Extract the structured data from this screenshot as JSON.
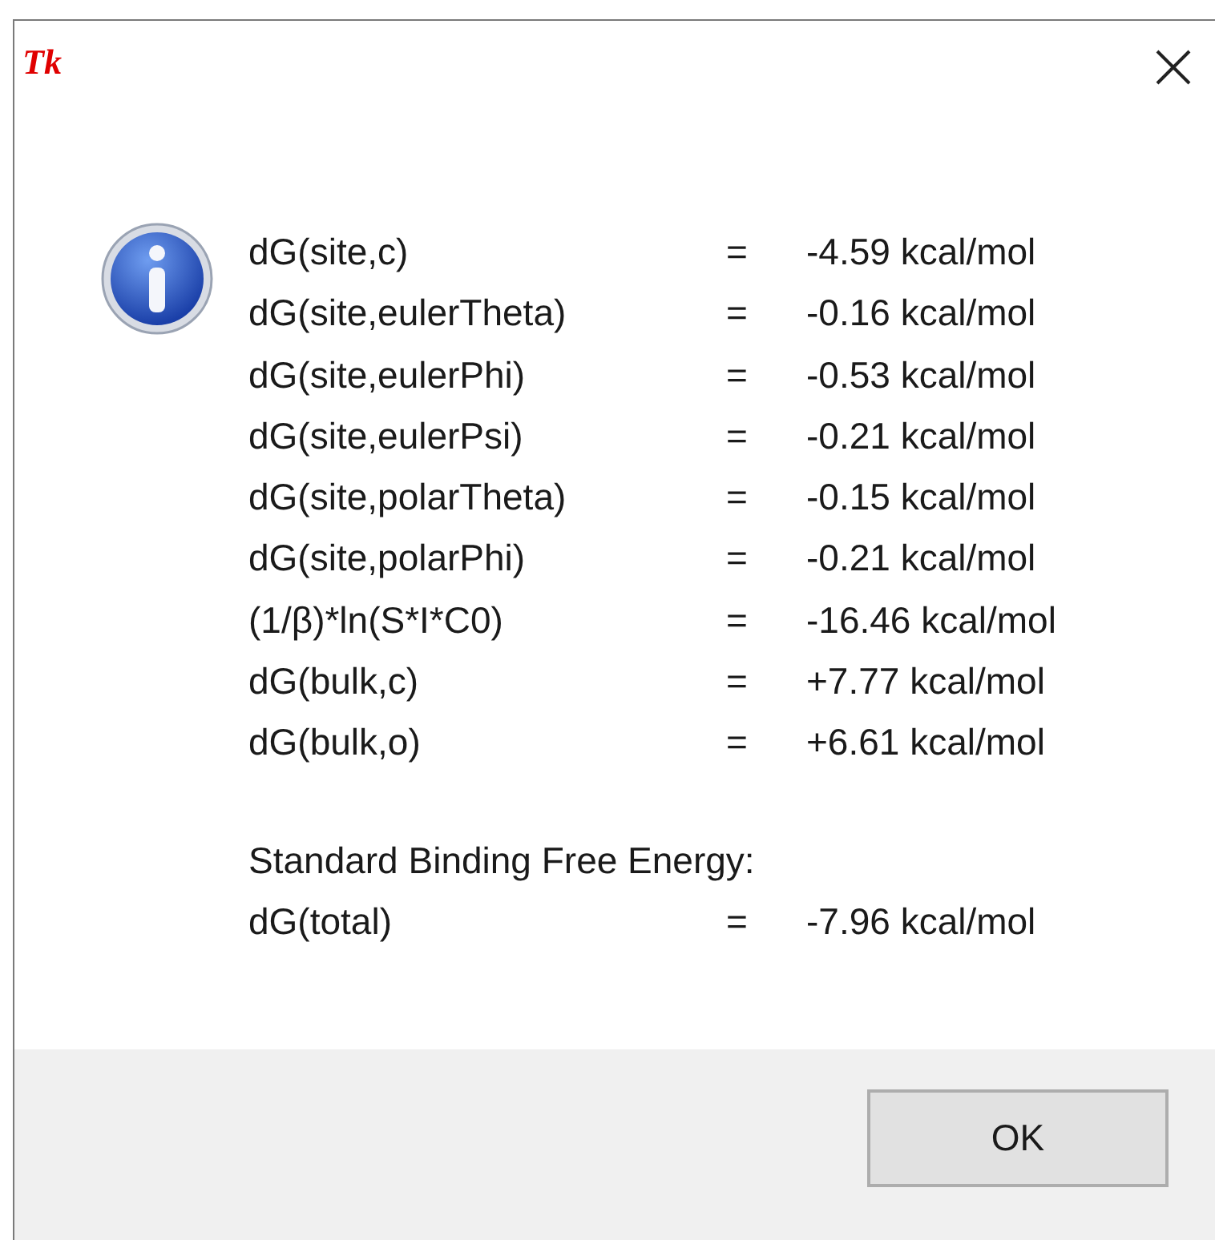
{
  "window": {
    "icon_text": "Tk"
  },
  "message": {
    "rows": [
      {
        "label": "dG(site,c)",
        "equals": "=",
        "value": "-4.59 kcal/mol"
      },
      {
        "label": "dG(site,eulerTheta)",
        "equals": "=",
        "value": "-0.16 kcal/mol"
      },
      {
        "label": "dG(site,eulerPhi)",
        "equals": "=",
        "value": "-0.53 kcal/mol"
      },
      {
        "label": "dG(site,eulerPsi)",
        "equals": "=",
        "value": "-0.21 kcal/mol"
      },
      {
        "label": "dG(site,polarTheta)",
        "equals": "=",
        "value": "-0.15 kcal/mol"
      },
      {
        "label": "dG(site,polarPhi)",
        "equals": "=",
        "value": "-0.21 kcal/mol"
      },
      {
        "label": "(1/β)*ln(S*I*C0)",
        "equals": "=",
        "value": "-16.46 kcal/mol"
      },
      {
        "label": "dG(bulk,c)",
        "equals": "=",
        "value": "+7.77 kcal/mol"
      },
      {
        "label": "dG(bulk,o)",
        "equals": "=",
        "value": "+6.61 kcal/mol"
      }
    ],
    "summary_heading": "Standard Binding Free Energy:",
    "total": {
      "label": "dG(total)",
      "equals": "=",
      "value": "-7.96 kcal/mol"
    }
  },
  "buttons": [
    "OK"
  ]
}
